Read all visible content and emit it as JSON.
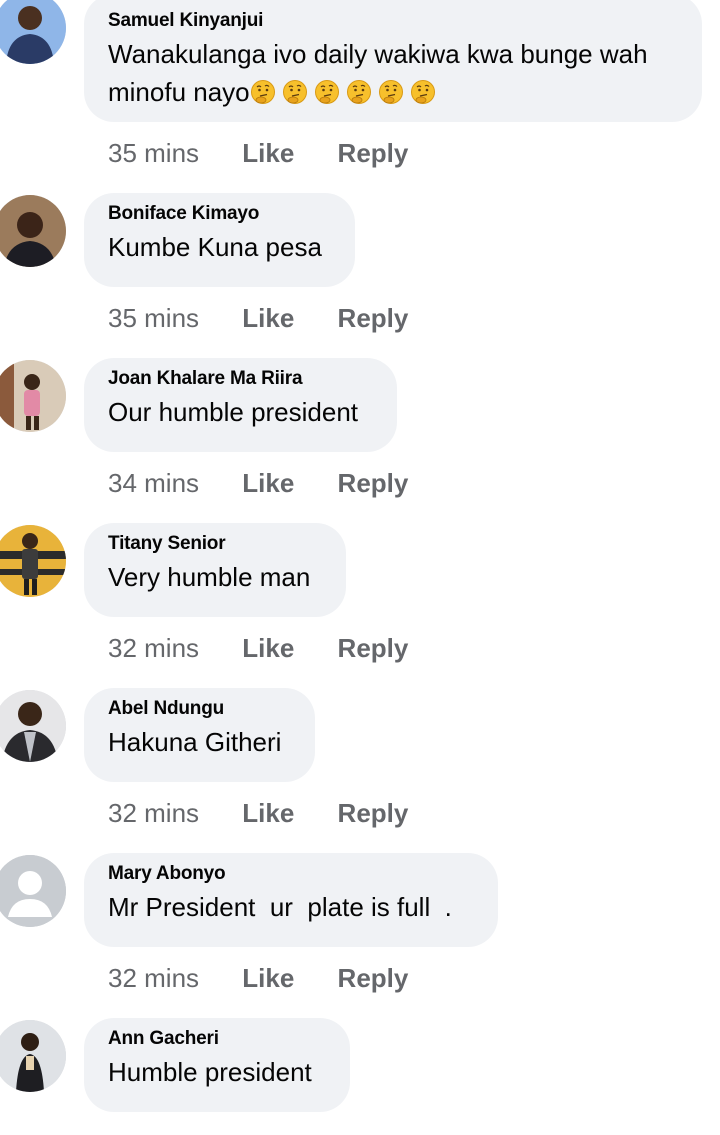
{
  "comments": [
    {
      "author": "Samuel Kinyanjui",
      "line1": "Wanakulanga ivo daily wakiwa kwa bunge wah",
      "line2": "minofu nayo",
      "emojis": [
        "thinking-face-emoji",
        "thinking-face-emoji",
        "thinking-face-emoji",
        "thinking-face-emoji",
        "thinking-face-emoji",
        "thinking-face-emoji"
      ],
      "time": "35 mins",
      "like": "Like",
      "reply": "Reply"
    },
    {
      "author": "Boniface Kimayo",
      "text": "Kumbe Kuna pesa",
      "time": "35 mins",
      "like": "Like",
      "reply": "Reply"
    },
    {
      "author": "Joan Khalare Ma Riira",
      "text": "Our humble president",
      "time": "34 mins",
      "like": "Like",
      "reply": "Reply"
    },
    {
      "author": "Titany Senior",
      "text": "Very humble man",
      "time": "32 mins",
      "like": "Like",
      "reply": "Reply"
    },
    {
      "author": "Abel Ndungu",
      "text": "Hakuna Githeri",
      "time": "32 mins",
      "like": "Like",
      "reply": "Reply"
    },
    {
      "author": "Mary Abonyo",
      "text": "Mr President  ur  plate is full  .",
      "time": "32 mins",
      "like": "Like",
      "reply": "Reply"
    },
    {
      "author": "Ann Gacheri",
      "text": "Humble president"
    }
  ],
  "colors": {
    "bubble": "#f0f2f5",
    "name": "#050505",
    "meta": "#65676b",
    "emoji": "#f7c02c"
  }
}
